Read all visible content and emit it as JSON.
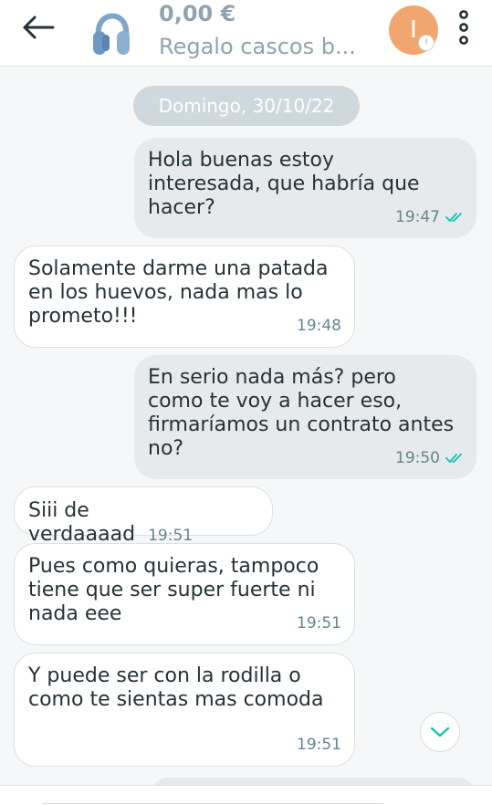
{
  "header": {
    "price": "0,00 €",
    "title": "Regalo cascos b...",
    "avatar_initial": "I",
    "avatar_badge": "!",
    "back_icon": "arrow-left-icon",
    "menu_icon": "more-vertical-icon",
    "thumb_icon": "headphones-icon"
  },
  "chat": {
    "date": "Domingo, 30/10/22",
    "messages": [
      {
        "dir": "out",
        "text": "Hola buenas estoy\ninteresada, que habría que\nhacer?",
        "time": "19:47",
        "read": true
      },
      {
        "dir": "in",
        "text": "Solamente darme una patada\nen los huevos, nada mas lo\nprometo!!!",
        "time": "19:48"
      },
      {
        "dir": "out",
        "text": "En serio nada más? pero\ncomo te voy a hacer eso,\nfirmaríamos un contrato antes\nno?",
        "time": "19:50",
        "read": true
      },
      {
        "dir": "in",
        "text": "Siii de verdaaaad",
        "time": "19:51"
      },
      {
        "dir": "in",
        "text": "Pues como quieras, tampoco\ntiene que ser super fuerte ni\nnada eee",
        "time": "19:51"
      },
      {
        "dir": "in",
        "text": "Y puede ser con la rodilla o\ncomo te sientas mas comoda",
        "time": "19:51"
      }
    ]
  },
  "colors": {
    "accent": "#13c1ac",
    "avatar": "#f2a66f",
    "muted_text": "#90a4ae",
    "time_text": "#62858f",
    "outgoing_bubble": "#e6eaec",
    "date_pill": "#cfd8dc"
  }
}
